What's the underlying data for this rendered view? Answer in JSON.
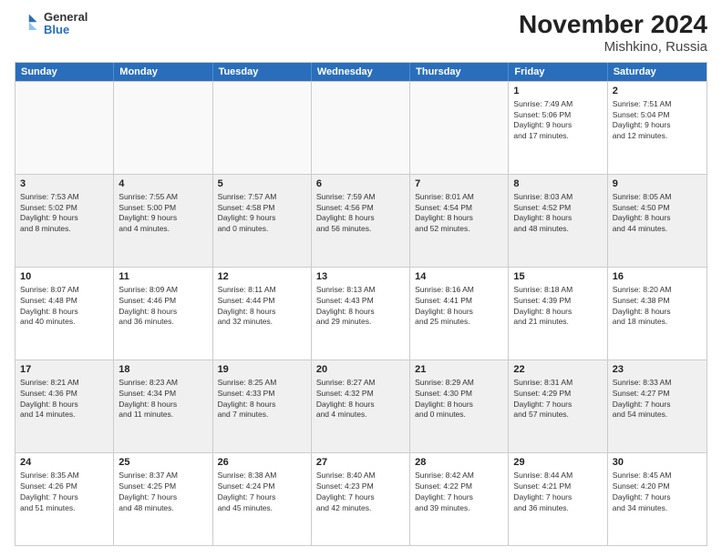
{
  "header": {
    "logo": {
      "general": "General",
      "blue": "Blue"
    },
    "title": "November 2024",
    "subtitle": "Mishkino, Russia"
  },
  "calendar": {
    "days": [
      "Sunday",
      "Monday",
      "Tuesday",
      "Wednesday",
      "Thursday",
      "Friday",
      "Saturday"
    ],
    "weeks": [
      [
        {
          "day": "",
          "lines": []
        },
        {
          "day": "",
          "lines": []
        },
        {
          "day": "",
          "lines": []
        },
        {
          "day": "",
          "lines": []
        },
        {
          "day": "",
          "lines": []
        },
        {
          "day": "1",
          "lines": [
            "Sunrise: 7:49 AM",
            "Sunset: 5:06 PM",
            "Daylight: 9 hours",
            "and 17 minutes."
          ]
        },
        {
          "day": "2",
          "lines": [
            "Sunrise: 7:51 AM",
            "Sunset: 5:04 PM",
            "Daylight: 9 hours",
            "and 12 minutes."
          ]
        }
      ],
      [
        {
          "day": "3",
          "lines": [
            "Sunrise: 7:53 AM",
            "Sunset: 5:02 PM",
            "Daylight: 9 hours",
            "and 8 minutes."
          ]
        },
        {
          "day": "4",
          "lines": [
            "Sunrise: 7:55 AM",
            "Sunset: 5:00 PM",
            "Daylight: 9 hours",
            "and 4 minutes."
          ]
        },
        {
          "day": "5",
          "lines": [
            "Sunrise: 7:57 AM",
            "Sunset: 4:58 PM",
            "Daylight: 9 hours",
            "and 0 minutes."
          ]
        },
        {
          "day": "6",
          "lines": [
            "Sunrise: 7:59 AM",
            "Sunset: 4:56 PM",
            "Daylight: 8 hours",
            "and 56 minutes."
          ]
        },
        {
          "day": "7",
          "lines": [
            "Sunrise: 8:01 AM",
            "Sunset: 4:54 PM",
            "Daylight: 8 hours",
            "and 52 minutes."
          ]
        },
        {
          "day": "8",
          "lines": [
            "Sunrise: 8:03 AM",
            "Sunset: 4:52 PM",
            "Daylight: 8 hours",
            "and 48 minutes."
          ]
        },
        {
          "day": "9",
          "lines": [
            "Sunrise: 8:05 AM",
            "Sunset: 4:50 PM",
            "Daylight: 8 hours",
            "and 44 minutes."
          ]
        }
      ],
      [
        {
          "day": "10",
          "lines": [
            "Sunrise: 8:07 AM",
            "Sunset: 4:48 PM",
            "Daylight: 8 hours",
            "and 40 minutes."
          ]
        },
        {
          "day": "11",
          "lines": [
            "Sunrise: 8:09 AM",
            "Sunset: 4:46 PM",
            "Daylight: 8 hours",
            "and 36 minutes."
          ]
        },
        {
          "day": "12",
          "lines": [
            "Sunrise: 8:11 AM",
            "Sunset: 4:44 PM",
            "Daylight: 8 hours",
            "and 32 minutes."
          ]
        },
        {
          "day": "13",
          "lines": [
            "Sunrise: 8:13 AM",
            "Sunset: 4:43 PM",
            "Daylight: 8 hours",
            "and 29 minutes."
          ]
        },
        {
          "day": "14",
          "lines": [
            "Sunrise: 8:16 AM",
            "Sunset: 4:41 PM",
            "Daylight: 8 hours",
            "and 25 minutes."
          ]
        },
        {
          "day": "15",
          "lines": [
            "Sunrise: 8:18 AM",
            "Sunset: 4:39 PM",
            "Daylight: 8 hours",
            "and 21 minutes."
          ]
        },
        {
          "day": "16",
          "lines": [
            "Sunrise: 8:20 AM",
            "Sunset: 4:38 PM",
            "Daylight: 8 hours",
            "and 18 minutes."
          ]
        }
      ],
      [
        {
          "day": "17",
          "lines": [
            "Sunrise: 8:21 AM",
            "Sunset: 4:36 PM",
            "Daylight: 8 hours",
            "and 14 minutes."
          ]
        },
        {
          "day": "18",
          "lines": [
            "Sunrise: 8:23 AM",
            "Sunset: 4:34 PM",
            "Daylight: 8 hours",
            "and 11 minutes."
          ]
        },
        {
          "day": "19",
          "lines": [
            "Sunrise: 8:25 AM",
            "Sunset: 4:33 PM",
            "Daylight: 8 hours",
            "and 7 minutes."
          ]
        },
        {
          "day": "20",
          "lines": [
            "Sunrise: 8:27 AM",
            "Sunset: 4:32 PM",
            "Daylight: 8 hours",
            "and 4 minutes."
          ]
        },
        {
          "day": "21",
          "lines": [
            "Sunrise: 8:29 AM",
            "Sunset: 4:30 PM",
            "Daylight: 8 hours",
            "and 0 minutes."
          ]
        },
        {
          "day": "22",
          "lines": [
            "Sunrise: 8:31 AM",
            "Sunset: 4:29 PM",
            "Daylight: 7 hours",
            "and 57 minutes."
          ]
        },
        {
          "day": "23",
          "lines": [
            "Sunrise: 8:33 AM",
            "Sunset: 4:27 PM",
            "Daylight: 7 hours",
            "and 54 minutes."
          ]
        }
      ],
      [
        {
          "day": "24",
          "lines": [
            "Sunrise: 8:35 AM",
            "Sunset: 4:26 PM",
            "Daylight: 7 hours",
            "and 51 minutes."
          ]
        },
        {
          "day": "25",
          "lines": [
            "Sunrise: 8:37 AM",
            "Sunset: 4:25 PM",
            "Daylight: 7 hours",
            "and 48 minutes."
          ]
        },
        {
          "day": "26",
          "lines": [
            "Sunrise: 8:38 AM",
            "Sunset: 4:24 PM",
            "Daylight: 7 hours",
            "and 45 minutes."
          ]
        },
        {
          "day": "27",
          "lines": [
            "Sunrise: 8:40 AM",
            "Sunset: 4:23 PM",
            "Daylight: 7 hours",
            "and 42 minutes."
          ]
        },
        {
          "day": "28",
          "lines": [
            "Sunrise: 8:42 AM",
            "Sunset: 4:22 PM",
            "Daylight: 7 hours",
            "and 39 minutes."
          ]
        },
        {
          "day": "29",
          "lines": [
            "Sunrise: 8:44 AM",
            "Sunset: 4:21 PM",
            "Daylight: 7 hours",
            "and 36 minutes."
          ]
        },
        {
          "day": "30",
          "lines": [
            "Sunrise: 8:45 AM",
            "Sunset: 4:20 PM",
            "Daylight: 7 hours",
            "and 34 minutes."
          ]
        }
      ]
    ]
  }
}
